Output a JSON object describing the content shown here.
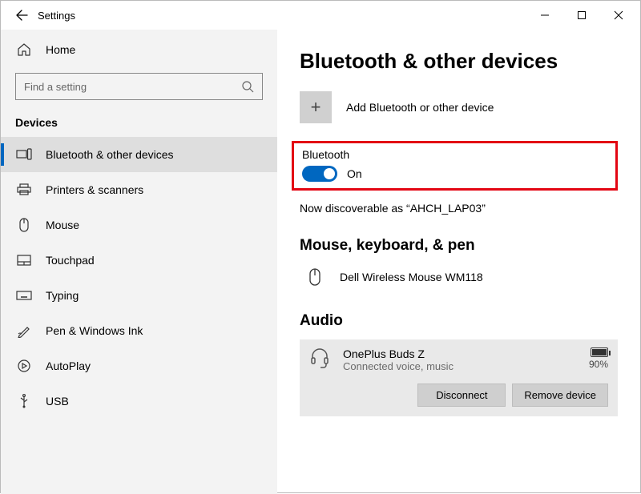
{
  "window": {
    "title": "Settings"
  },
  "home": {
    "label": "Home"
  },
  "search": {
    "placeholder": "Find a setting"
  },
  "sidebar": {
    "section": "Devices",
    "items": [
      {
        "label": "Bluetooth & other devices"
      },
      {
        "label": "Printers & scanners"
      },
      {
        "label": "Mouse"
      },
      {
        "label": "Touchpad"
      },
      {
        "label": "Typing"
      },
      {
        "label": "Pen & Windows Ink"
      },
      {
        "label": "AutoPlay"
      },
      {
        "label": "USB"
      }
    ]
  },
  "page": {
    "title": "Bluetooth & other devices",
    "add_label": "Add Bluetooth or other device",
    "bt_heading": "Bluetooth",
    "bt_toggle_state": "On",
    "discover_text": "Now discoverable as “AHCH_LAP03”",
    "mouse_heading": "Mouse, keyboard, & pen",
    "mouse_device": "Dell Wireless Mouse WM118",
    "audio_heading": "Audio",
    "audio_device": {
      "name": "OnePlus Buds Z",
      "status": "Connected voice, music",
      "battery_pct": "90%"
    },
    "btn_disconnect": "Disconnect",
    "btn_remove": "Remove device"
  }
}
